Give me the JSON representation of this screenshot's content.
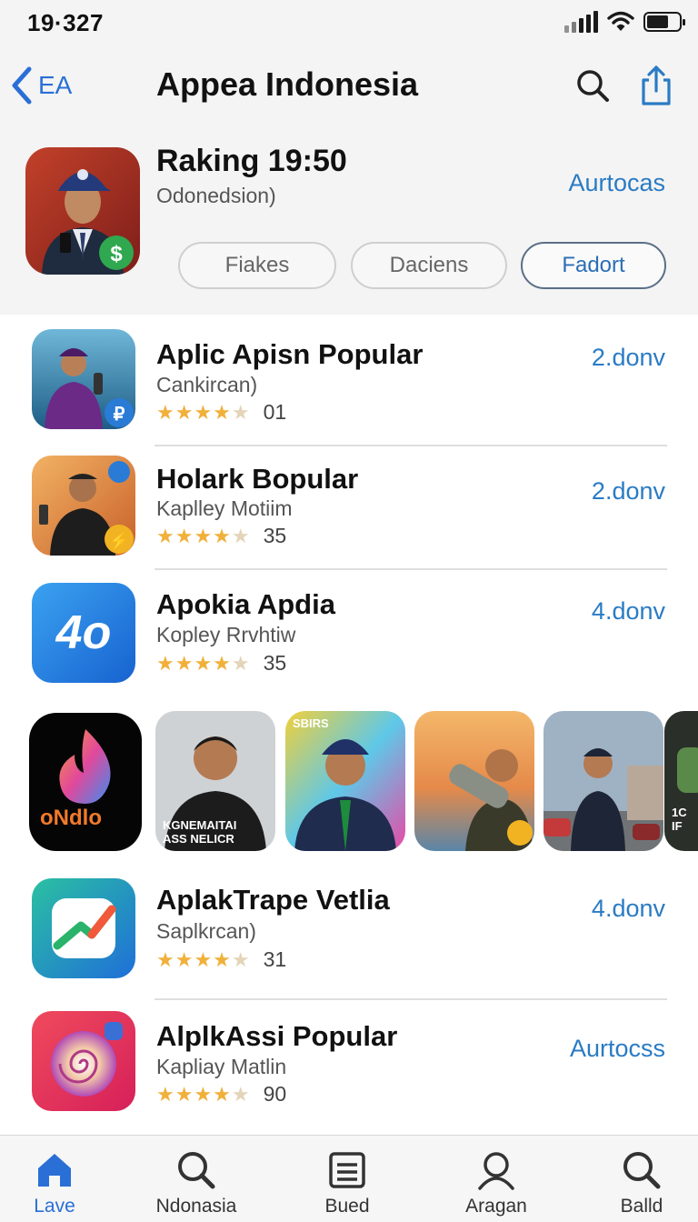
{
  "status_bar": {
    "time": "19·327"
  },
  "header": {
    "back_label": "EA",
    "title": "Appea Indonesia",
    "hero": {
      "title": "Raking 19:50",
      "subtitle": "Odonedsion)",
      "action": "Aurtocas"
    },
    "filters": [
      {
        "label": "Fiakes",
        "active": false
      },
      {
        "label": "Daciens",
        "active": false
      },
      {
        "label": "Fadort",
        "active": true
      }
    ]
  },
  "apps": [
    {
      "title": "Aplic Apisn Popular",
      "subtitle": "Cankircan)",
      "stars": 4,
      "count": "01",
      "action": "2.donv",
      "icon": "person-ocean-icon"
    },
    {
      "title": "Holark Bopular",
      "subtitle": "Kaplley Motiim",
      "stars": 4,
      "count": "35",
      "action": "2.donv",
      "icon": "person-orange-icon"
    },
    {
      "title": "Apokia Apdia",
      "subtitle": "Kopley Rrvhtiw",
      "stars": 4,
      "count": "35",
      "action": "4.donv",
      "icon": "blue-40-icon"
    },
    {
      "title": "AplakTrape Vetlia",
      "subtitle": "Saplkrcan)",
      "stars": 4,
      "count": "31",
      "action": "4.donv",
      "icon": "chart-arrow-icon"
    },
    {
      "title": "AlplkAssi Popular",
      "subtitle": "Kapliay Matlin",
      "stars": 4,
      "count": "90",
      "action": "Aurtocss",
      "icon": "swirl-icon"
    }
  ],
  "featured": {
    "app_wordmark": "oNdlo",
    "thumbs": [
      {
        "badge": "",
        "caption": "KGNEMAITAI\nASS NELICR"
      },
      {
        "badge": "SBIRS",
        "caption": ""
      },
      {
        "badge": "",
        "caption": ""
      },
      {
        "badge": "",
        "caption": ""
      },
      {
        "badge": "",
        "caption": "1C\nIF"
      }
    ]
  },
  "tabs": [
    {
      "label": "Lave",
      "icon": "home-icon",
      "active": true
    },
    {
      "label": "Ndonasia",
      "icon": "search-icon",
      "active": false
    },
    {
      "label": "Bued",
      "icon": "list-icon",
      "active": false
    },
    {
      "label": "Aragan",
      "icon": "person-icon",
      "active": false
    },
    {
      "label": "Balld",
      "icon": "search-icon",
      "active": false
    }
  ],
  "colors": {
    "accent": "#2a6fd6",
    "link": "#2a7bc4",
    "star": "#f0b03a"
  }
}
